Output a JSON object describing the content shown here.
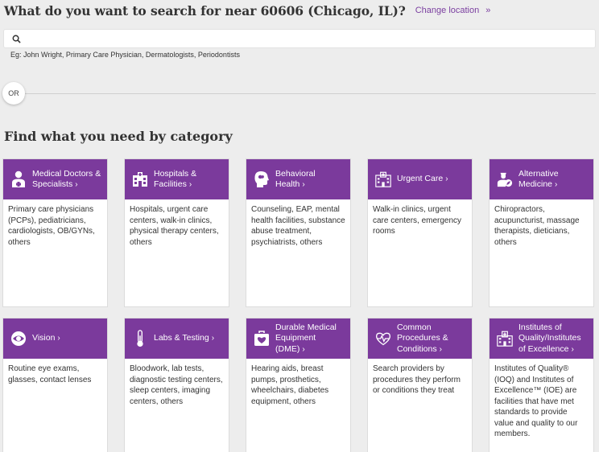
{
  "header": {
    "title": "What do you want to search for near 60606 (Chicago, IL)?",
    "change_location": "Change location",
    "chevron": "»"
  },
  "search": {
    "placeholder": "",
    "value": "",
    "example": "Eg: John Wright, Primary Care Physician, Dermatologists, Periodontists"
  },
  "or_label": "OR",
  "category_title": "Find what you need by category",
  "categories": [
    {
      "label": "Medical Doctors & Specialists",
      "icon": "doctor-icon",
      "desc": "Primary care physicians (PCPs), pediatricians, cardiologists, OB/GYNs, others"
    },
    {
      "label": "Hospitals & Facilities",
      "icon": "hospital-icon",
      "desc": "Hospitals, urgent care centers, walk-in clinics, physical therapy centers, others"
    },
    {
      "label": "Behavioral Health",
      "icon": "head-brain-icon",
      "desc": "Counseling, EAP, mental health facilities, substance abuse treatment, psychiatrists, others"
    },
    {
      "label": "Urgent Care",
      "icon": "urgent-care-building-icon",
      "desc": "Walk-in clinics, urgent care centers, emergency rooms"
    },
    {
      "label": "Alternative Medicine",
      "icon": "alternative-medicine-icon",
      "desc": "Chiropractors, acupuncturist, massage therapists, dieticians, others"
    },
    {
      "label": "Vision",
      "icon": "eye-icon",
      "desc": "Routine eye exams, glasses, contact lenses"
    },
    {
      "label": "Labs & Testing",
      "icon": "thermometer-icon",
      "desc": "Bloodwork, lab tests, diagnostic testing centers, sleep centers, imaging centers, others"
    },
    {
      "label": "Durable Medical Equipment (DME)",
      "icon": "medical-bag-icon",
      "desc": "Hearing aids, breast pumps, prosthetics, wheelchairs, diabetes equipment, others"
    },
    {
      "label": "Common Procedures & Conditions",
      "icon": "heartbeat-icon",
      "desc": "Search providers by procedures they perform or conditions they treat"
    },
    {
      "label": "Institutes of Quality/Institutes of Excellence",
      "icon": "institute-building-icon",
      "desc": "Institutes of Quality® (IOQ) and Institutes of Excellence™ (IOE) are facilities that have met standards to provide value and quality to our members."
    }
  ],
  "arrow": "›",
  "colors": {
    "accent": "#7b3a9c",
    "link": "#7b3fa0",
    "background": "#ededed"
  }
}
